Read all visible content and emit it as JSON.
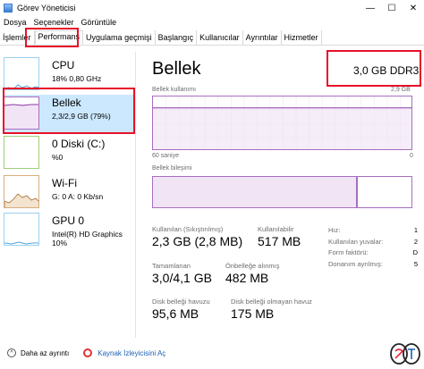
{
  "window": {
    "title": "Görev Yöneticisi",
    "minimize": "—",
    "maximize": "☐",
    "close": "✕"
  },
  "menu": [
    "Dosya",
    "Seçenekler",
    "Görüntüle"
  ],
  "tabs": [
    "İşlemler",
    "Performans",
    "Uygulama geçmişi",
    "Başlangıç",
    "Kullanıcılar",
    "Ayrıntılar",
    "Hizmetler"
  ],
  "active_tab": "Performans",
  "sidebar": [
    {
      "name": "CPU",
      "line1": "18%  0,80 GHz",
      "line2": "",
      "thumb_color": "#4fa3dd"
    },
    {
      "name": "Bellek",
      "line1": "2,3/2,9 GB (79%)",
      "line2": "",
      "thumb_color": "#8b3aa8"
    },
    {
      "name": "0 Diski (C:)",
      "line1": "%0",
      "line2": "",
      "thumb_color": "#5b9a2c"
    },
    {
      "name": "Wi-Fi",
      "line1": "G: 0 A: 0 Kb/sn",
      "line2": "",
      "thumb_color": "#a56a2a"
    },
    {
      "name": "GPU 0",
      "line1": "Intel(R) HD Graphics",
      "line2": "10%",
      "thumb_color": "#4fa3dd"
    }
  ],
  "main": {
    "title": "Bellek",
    "spec": "3,0 GB DDR3",
    "usage_label": "Bellek kullanımı",
    "usage_max": "2,9 GB",
    "time_label": "60 saniye",
    "time_zero": "0",
    "composition_label": "Bellek bileşimi",
    "usage_level": 0.79,
    "composition_in_use": 0.79,
    "composition_modified": 0.0
  },
  "stats": {
    "in_use_label": "Kullanılan (Sıkıştırılmış)",
    "in_use_value": "2,3 GB (2,8 MB)",
    "available_label": "Kullanılabilir",
    "available_value": "517 MB",
    "committed_label": "Tamamlanan",
    "committed_value": "3,0/4,1 GB",
    "cached_label": "Önbelleğe alınmış",
    "cached_value": "482 MB",
    "paged_label": "Disk belleği havuzu",
    "paged_value": "95,6 MB",
    "nonpaged_label": "Disk belleği olmayan havuz",
    "nonpaged_value": "175 MB"
  },
  "right_list": [
    {
      "label": "Hız:",
      "value": "1"
    },
    {
      "label": "Kullanılan yuvalar:",
      "value": "2"
    },
    {
      "label": "Form faktörü:",
      "value": "D"
    },
    {
      "label": "Donanım ayrılmış:",
      "value": "5"
    }
  ],
  "footer": {
    "less_details": "Daha az ayrıntı",
    "open_resmon": "Kaynak İzleyicisini Aç"
  },
  "colors": {
    "accent": "#8b3aa8",
    "highlight": "#e8102a",
    "selected_bg": "#cce8ff"
  }
}
